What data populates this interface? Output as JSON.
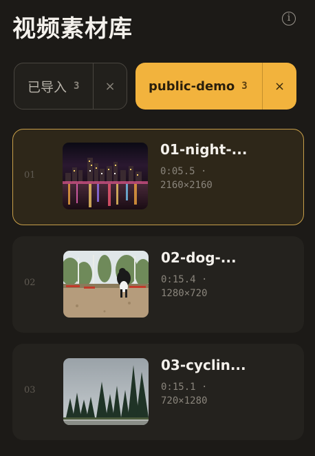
{
  "header": {
    "title": "视频素材库",
    "info_icon": "info-icon",
    "info_glyph": "i"
  },
  "filters": [
    {
      "label": "已导入",
      "count": "3",
      "close": "×",
      "active": false
    },
    {
      "label": "public-demo",
      "count": "3",
      "close": "×",
      "active": true
    }
  ],
  "clips": [
    {
      "index": "01",
      "name": "01-night-...",
      "duration": "0:05.5",
      "separator": "·",
      "resolution": "2160×2160",
      "selected": true
    },
    {
      "index": "02",
      "name": "02-dog-...",
      "duration": "0:15.4",
      "separator": "·",
      "resolution": "1280×720",
      "selected": false
    },
    {
      "index": "03",
      "name": "03-cyclin...",
      "duration": "0:15.1",
      "separator": "·",
      "resolution": "720×1280",
      "selected": false
    }
  ],
  "colors": {
    "background": "#1c1a17",
    "accent": "#f2b33d",
    "selected_border": "#c9a04a"
  }
}
